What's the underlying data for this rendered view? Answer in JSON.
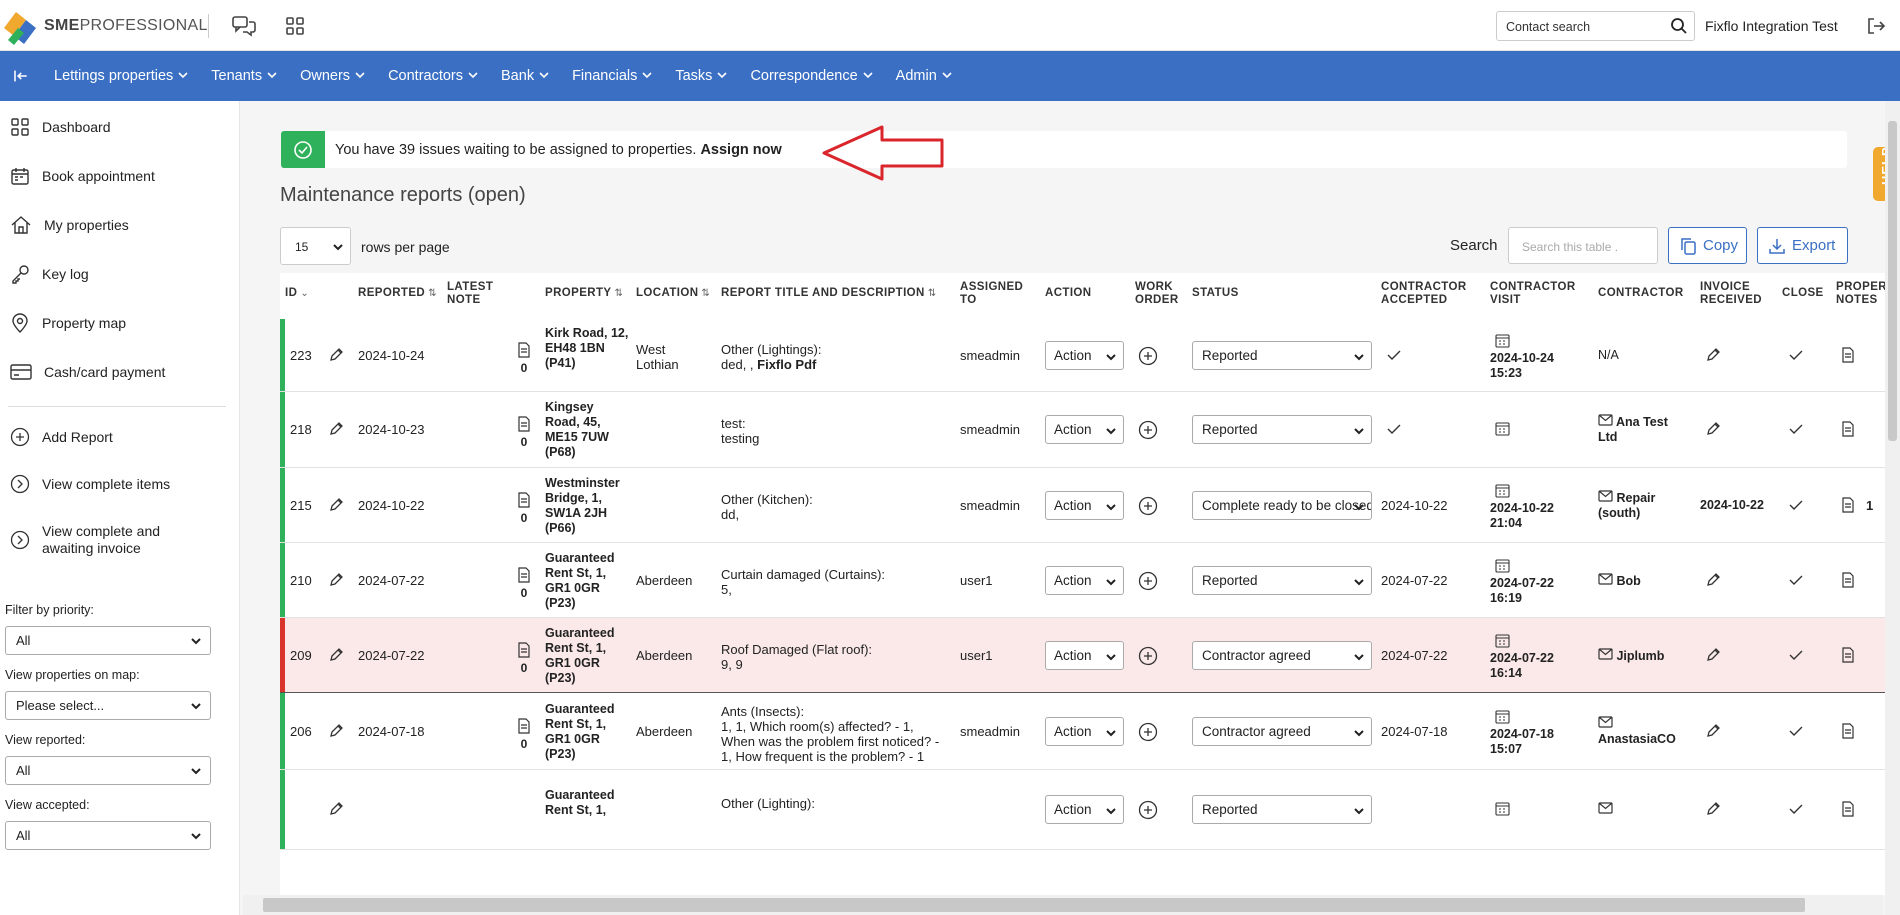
{
  "brand": {
    "name_bold": "SME",
    "name_rest": "PROFESSIONAL"
  },
  "topbar": {
    "contact_search_placeholder": "Contact search",
    "user_name": "Fixflo Integration Test"
  },
  "nav": {
    "items": [
      "Lettings properties",
      "Tenants",
      "Owners",
      "Contractors",
      "Bank",
      "Financials",
      "Tasks",
      "Correspondence",
      "Admin"
    ]
  },
  "sidebar": {
    "items": [
      "Dashboard",
      "Book appointment",
      "My properties",
      "Key log",
      "Property map",
      "Cash/card payment"
    ],
    "actions": [
      "Add Report",
      "View complete items",
      "View complete and awaiting invoice"
    ],
    "filters": [
      {
        "label": "Filter by priority:",
        "value": "All"
      },
      {
        "label": "View properties on map:",
        "value": "Please select..."
      },
      {
        "label": "View reported:",
        "value": "All"
      },
      {
        "label": "View accepted:",
        "value": "All"
      }
    ]
  },
  "alert": {
    "text": "You have 39 issues waiting to be assigned to properties.",
    "link": "Assign now"
  },
  "page": {
    "title": "Maintenance reports (open)",
    "rows_value": "15",
    "rows_label": "rows per page",
    "search_label": "Search",
    "search_placeholder": "Search this table .",
    "copy_label": "Copy",
    "export_label": "Export",
    "help_label": "HELP"
  },
  "columns": [
    "ID",
    "REPORTED",
    "LATEST NOTE",
    "PROPERTY",
    "LOCATION",
    "REPORT TITLE AND DESCRIPTION",
    "ASSIGNED TO",
    "ACTION",
    "WORK ORDER",
    "STATUS",
    "CONTRACTOR ACCEPTED",
    "CONTRACTOR VISIT",
    "CONTRACTOR",
    "INVOICE RECEIVED",
    "CLOSE",
    "PROPERTY NOTES"
  ],
  "rows": [
    {
      "id": "223",
      "reported": "2024-10-24",
      "note": "0",
      "property": "Kirk Road, 12, EH48 1BN (P41)",
      "location": "West Lothian",
      "title": "Other (Lightings):",
      "desc": "ded, , ",
      "desc_bold": "Fixflo Pdf",
      "assigned": "smeadmin",
      "action": "Action",
      "status": "Reported",
      "accepted": "",
      "accepted_check": true,
      "visit": "2024-10-24 15:23",
      "contractor": "N/A",
      "contractor_mail": false,
      "invoice": "",
      "prop_notes": "",
      "highlight": false,
      "stripe": "#2fb15b"
    },
    {
      "id": "218",
      "reported": "2024-10-23",
      "note": "0",
      "property": "Kingsey Road, 45, ME15 7UW (P68)",
      "location": "",
      "title": "test:",
      "desc": "testing",
      "desc_bold": "",
      "assigned": "smeadmin",
      "action": "Action",
      "status": "Reported",
      "accepted": "",
      "accepted_check": true,
      "visit": "",
      "contractor": "Ana Test Ltd",
      "contractor_mail": true,
      "invoice": "",
      "prop_notes": "",
      "highlight": false,
      "stripe": "#2fb15b"
    },
    {
      "id": "215",
      "reported": "2024-10-22",
      "note": "0",
      "property": "Westminster Bridge, 1, SW1A 2JH (P66)",
      "location": "",
      "title": "Other (Kitchen):",
      "desc": "dd,",
      "desc_bold": "",
      "assigned": "smeadmin",
      "action": "Action",
      "status": "Complete ready to be closed",
      "accepted": "2024-10-22",
      "accepted_check": false,
      "visit": "2024-10-22 21:04",
      "contractor": "Repair (south)",
      "contractor_mail": true,
      "invoice": "2024-10-22",
      "prop_notes": "1",
      "highlight": false,
      "stripe": "#2fb15b"
    },
    {
      "id": "210",
      "reported": "2024-07-22",
      "note": "0",
      "property": "Guaranteed Rent St, 1, GR1 0GR (P23)",
      "location": "Aberdeen",
      "title": "Curtain damaged (Curtains):",
      "desc": "5,",
      "desc_bold": "",
      "assigned": "user1",
      "action": "Action",
      "status": "Reported",
      "accepted": "2024-07-22",
      "accepted_check": false,
      "visit": "2024-07-22 16:19",
      "contractor": "Bob",
      "contractor_mail": true,
      "invoice": "",
      "prop_notes": "",
      "highlight": false,
      "stripe": "#2fb15b"
    },
    {
      "id": "209",
      "reported": "2024-07-22",
      "note": "0",
      "property": "Guaranteed Rent St, 1, GR1 0GR (P23)",
      "location": "Aberdeen",
      "title": "Roof Damaged (Flat roof):",
      "desc": "9, 9",
      "desc_bold": "",
      "assigned": "user1",
      "action": "Action",
      "status": "Contractor agreed",
      "accepted": "2024-07-22",
      "accepted_check": false,
      "visit": "2024-07-22 16:14",
      "contractor": "Jiplumb",
      "contractor_mail": true,
      "invoice": "",
      "prop_notes": "",
      "highlight": true,
      "stripe": "#d9342b"
    },
    {
      "id": "206",
      "reported": "2024-07-18",
      "note": "0",
      "property": "Guaranteed Rent St, 1, GR1 0GR (P23)",
      "location": "Aberdeen",
      "title": "Ants (Insects):",
      "desc": "1, 1, Which room(s) affected? - 1, When was the problem first noticed? - 1, How frequent is the problem? - 1",
      "desc_bold": "",
      "assigned": "smeadmin",
      "action": "Action",
      "status": "Contractor agreed",
      "accepted": "2024-07-18",
      "accepted_check": false,
      "visit": "2024-07-18 15:07",
      "contractor": "AnastasiaCO",
      "contractor_mail": true,
      "invoice": "",
      "prop_notes": "",
      "highlight": false,
      "stripe": "#2fb15b"
    },
    {
      "id": "",
      "reported": "",
      "note": "",
      "property": "Guaranteed Rent St, 1,",
      "location": "",
      "title": "Other (Lighting):",
      "desc": "",
      "desc_bold": "",
      "assigned": "",
      "action": "Action",
      "status": "Reported",
      "accepted": "",
      "accepted_check": false,
      "visit": "",
      "contractor": "",
      "contractor_mail": true,
      "invoice": "",
      "prop_notes": "",
      "highlight": false,
      "stripe": "#2fb15b"
    }
  ]
}
